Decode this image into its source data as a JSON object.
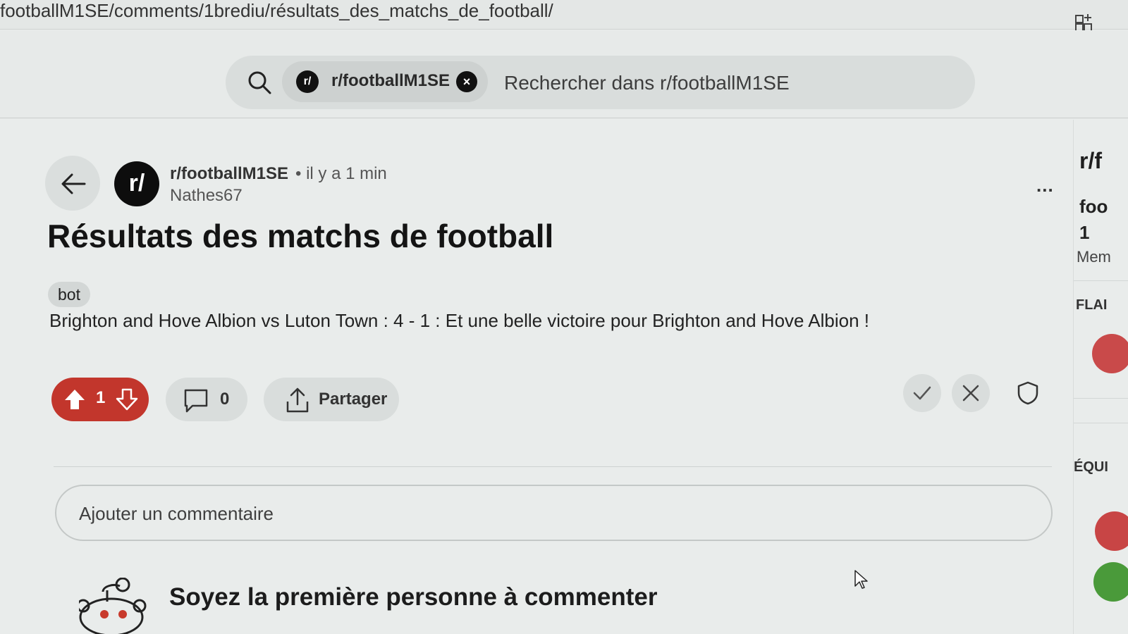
{
  "browser": {
    "url": "footballM1SE/comments/1brediu/résultats_des_matchs_de_football/",
    "grid_icon": "grid-plus-icon"
  },
  "search": {
    "community_chip": "r/footballM1SE",
    "chip_avatar": "r/",
    "placeholder": "Rechercher dans r/footballM1SE"
  },
  "post": {
    "subreddit": "r/footballM1SE",
    "separator_time": "• il y a 1 min",
    "author": "Nathes67",
    "avatar_text": "r/",
    "more": "...",
    "title": "Résultats des matchs de football",
    "flair": "bot",
    "body": "Brighton and Hove Albion vs Luton Town : 4 - 1 : Et une belle victoire pour Brighton and Hove Albion !"
  },
  "actions": {
    "votes": "1",
    "comments": "0",
    "share": "Partager",
    "vote_color": "#c2362c"
  },
  "comments": {
    "placeholder": "Ajouter un commentaire",
    "empty_message": "Soyez la première personne à commenter"
  },
  "sidebar": {
    "title": "r/f",
    "name": "foo",
    "count": "1",
    "members": "Mem",
    "flair_heading": "FLAI",
    "team_heading": "ÉQUI"
  }
}
